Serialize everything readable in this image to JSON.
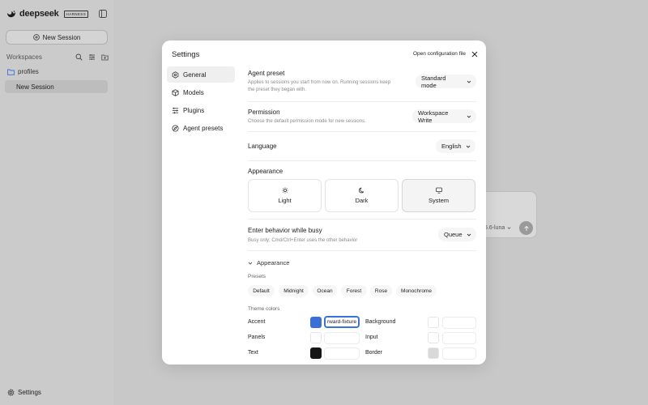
{
  "app": {
    "brand_name": "deepseek",
    "brand_badge": "HARNESS",
    "new_session_label": "New Session",
    "workspaces_label": "Workspaces",
    "folder_name": "profiles",
    "session_name": "New Session",
    "settings_label": "Settings",
    "background_model_label": "5.6-luna"
  },
  "settings": {
    "title": "Settings",
    "open_config_label": "Open configuration file",
    "tabs": [
      {
        "label": "General",
        "icon": "hexagon-icon",
        "active": true
      },
      {
        "label": "Models",
        "icon": "cube-icon",
        "active": false
      },
      {
        "label": "Plugins",
        "icon": "sliders-icon",
        "active": false
      },
      {
        "label": "Agent presets",
        "icon": "compass-icon",
        "active": false
      }
    ],
    "agent_preset": {
      "title": "Agent preset",
      "description_line1": "Applies to sessions you start from now on. Running sessions keep",
      "description_line2": "the preset they began with.",
      "value": "Standard mode"
    },
    "permission": {
      "title": "Permission",
      "description": "Choose the default permission mode for new sessions.",
      "value": "Workspace Write"
    },
    "language": {
      "title": "Language",
      "value": "English"
    },
    "appearance": {
      "title": "Appearance",
      "options": [
        {
          "label": "Light",
          "icon": "sun-icon",
          "selected": false
        },
        {
          "label": "Dark",
          "icon": "moon-icon",
          "selected": false
        },
        {
          "label": "System",
          "icon": "monitor-icon",
          "selected": true
        }
      ]
    },
    "busy_behavior": {
      "title": "Enter behavior while busy",
      "description": "Busy only; Cmd/Ctrl+Enter uses the other behavior",
      "value": "Queue"
    },
    "appearance_section": {
      "toggle_label": "Appearance",
      "presets_label": "Presets",
      "presets": [
        "Default",
        "Midnight",
        "Ocean",
        "Forest",
        "Rose",
        "Monochrome"
      ],
      "theme_colors_label": "Theme colors",
      "colors": {
        "accent": {
          "label": "Accent",
          "color": "#3b6fd8",
          "value": "rward-fixture"
        },
        "panels": {
          "label": "Panels",
          "color": "#ffffff",
          "value": ""
        },
        "text": {
          "label": "Text",
          "color": "#151515",
          "value": ""
        },
        "background": {
          "label": "Background",
          "color": "#ffffff",
          "value": ""
        },
        "input": {
          "label": "Input",
          "color": "#ffffff",
          "value": ""
        },
        "border": {
          "label": "Border",
          "color": "#d9d9d9",
          "value": ""
        }
      }
    }
  }
}
